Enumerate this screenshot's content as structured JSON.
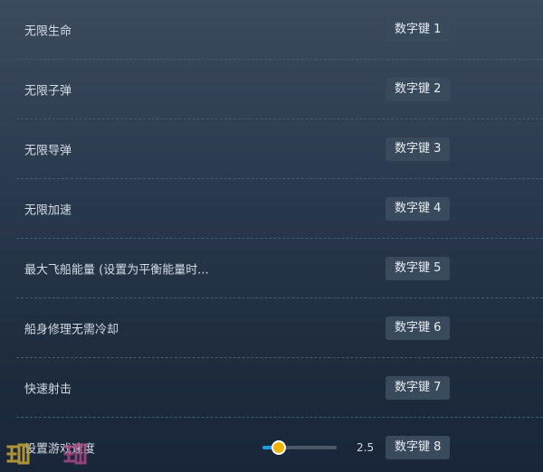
{
  "cheats": [
    {
      "label": "无限生命",
      "key": "数字键 1"
    },
    {
      "label": "无限子弹",
      "key": "数字键 2"
    },
    {
      "label": "无限导弹",
      "key": "数字键 3"
    },
    {
      "label": "无限加速",
      "key": "数字键 4"
    },
    {
      "label": "最大飞船能量 (设置为平衡能量时...",
      "key": "数字键 5"
    },
    {
      "label": "船身修理无需冷却",
      "key": "数字键 6"
    },
    {
      "label": "快速射击",
      "key": "数字键 7"
    },
    {
      "label": "设置游戏速度",
      "key": "数字键 8"
    }
  ],
  "speed_slider": {
    "value": "2.5",
    "fill_fraction": 0.22
  },
  "colors": {
    "slider_fill": "#1aa0e0",
    "slider_thumb": "#f0b400",
    "key_badge_bg": "#3a4a5d"
  }
}
